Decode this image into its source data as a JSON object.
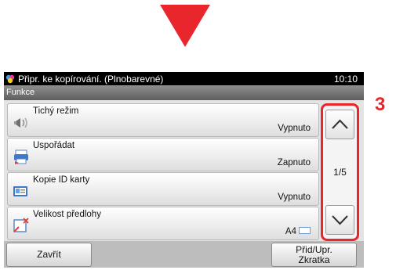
{
  "header": {
    "title": "Připr. ke kopírování. (Plnobarevné)",
    "clock": "10:10"
  },
  "section": {
    "label": "Funkce"
  },
  "functions": [
    {
      "label": "Tichý režim",
      "value": "Vypnuto",
      "icon": "quiet-mode-icon"
    },
    {
      "label": "Uspořádat",
      "value": "Zapnuto",
      "icon": "collate-icon"
    },
    {
      "label": "Kopie ID karty",
      "value": "Vypnuto",
      "icon": "id-card-icon"
    },
    {
      "label": "Velikost předlohy",
      "value": "A4",
      "icon": "original-size-icon"
    }
  ],
  "scroll": {
    "page_indicator": "1/5"
  },
  "callout": "3",
  "footer": {
    "close_label": "Zavřít",
    "add_label_1": "Přid/Upr.",
    "add_label_2": "Zkratka"
  },
  "colors": {
    "accent": "#e8262c",
    "titlebar": "#000000"
  }
}
